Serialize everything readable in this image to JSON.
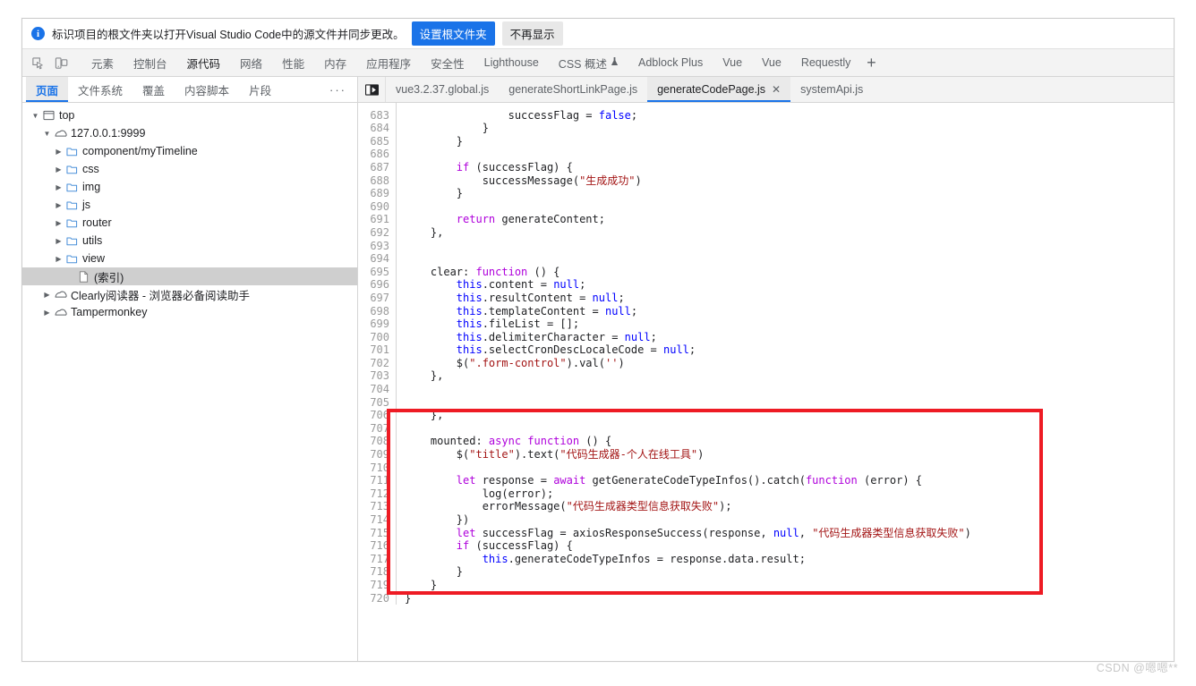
{
  "infobar": {
    "icon": "info-icon",
    "message": "标识项目的根文件夹以打开Visual Studio Code中的源文件并同步更改。",
    "primary_button": "设置根文件夹",
    "secondary_button": "不再显示"
  },
  "main_tabs": {
    "inspect_icon": "inspect-element-icon",
    "device_icon": "device-toolbar-icon",
    "add_label": "+",
    "items": [
      {
        "label": "元素",
        "selected": false
      },
      {
        "label": "控制台",
        "selected": false
      },
      {
        "label": "源代码",
        "selected": true
      },
      {
        "label": "网络",
        "selected": false
      },
      {
        "label": "性能",
        "selected": false
      },
      {
        "label": "内存",
        "selected": false
      },
      {
        "label": "应用程序",
        "selected": false
      },
      {
        "label": "安全性",
        "selected": false
      },
      {
        "label": "Lighthouse",
        "selected": false
      },
      {
        "label": "CSS 概述",
        "selected": false,
        "flask": true
      },
      {
        "label": "Adblock Plus",
        "selected": false
      },
      {
        "label": "Vue",
        "selected": false
      },
      {
        "label": "Vue",
        "selected": false
      },
      {
        "label": "Requestly",
        "selected": false
      }
    ]
  },
  "navigator": {
    "tabs": [
      {
        "label": "页面",
        "selected": true
      },
      {
        "label": "文件系统",
        "selected": false
      },
      {
        "label": "覆盖",
        "selected": false
      },
      {
        "label": "内容脚本",
        "selected": false
      },
      {
        "label": "片段",
        "selected": false
      }
    ],
    "more_label": "···",
    "tree": [
      {
        "label": "top",
        "indent": 0,
        "icon": "frame-icon",
        "arrow": "down",
        "selected": false
      },
      {
        "label": "127.0.0.1:9999",
        "indent": 1,
        "icon": "cloud-icon",
        "arrow": "down",
        "selected": false
      },
      {
        "label": "component/myTimeline",
        "indent": 2,
        "icon": "folder-icon",
        "arrow": "right",
        "selected": false
      },
      {
        "label": "css",
        "indent": 2,
        "icon": "folder-icon",
        "arrow": "right",
        "selected": false
      },
      {
        "label": "img",
        "indent": 2,
        "icon": "folder-icon",
        "arrow": "right",
        "selected": false
      },
      {
        "label": "js",
        "indent": 2,
        "icon": "folder-icon",
        "arrow": "right",
        "selected": false
      },
      {
        "label": "router",
        "indent": 2,
        "icon": "folder-icon",
        "arrow": "right",
        "selected": false
      },
      {
        "label": "utils",
        "indent": 2,
        "icon": "folder-icon",
        "arrow": "right",
        "selected": false
      },
      {
        "label": "view",
        "indent": 2,
        "icon": "folder-icon",
        "arrow": "right",
        "selected": false
      },
      {
        "label": "(索引)",
        "indent": 3,
        "icon": "document-icon",
        "arrow": "none",
        "selected": true
      },
      {
        "label": "Clearly阅读器 - 浏览器必备阅读助手",
        "indent": 1,
        "icon": "cloud-icon",
        "arrow": "right",
        "selected": false
      },
      {
        "label": "Tampermonkey",
        "indent": 1,
        "icon": "cloud-icon",
        "arrow": "right",
        "selected": false
      }
    ]
  },
  "sources": {
    "collapse_icon": "collapse-sidebar-icon",
    "file_tabs": [
      {
        "label": "vue3.2.37.global.js",
        "selected": false,
        "closable": false
      },
      {
        "label": "generateShortLinkPage.js",
        "selected": false,
        "closable": false
      },
      {
        "label": "generateCodePage.js",
        "selected": true,
        "closable": true
      },
      {
        "label": "systemApi.js",
        "selected": false,
        "closable": false
      }
    ],
    "close_glyph": "✕",
    "code": [
      {
        "n": "",
        "segs": [
          {
            "t": "                ",
            "c": ""
          }
        ]
      },
      {
        "n": "683",
        "segs": [
          {
            "t": "                ",
            "c": ""
          },
          {
            "t": "successFlag = ",
            "c": ""
          },
          {
            "t": "false",
            "c": "kw2"
          },
          {
            "t": ";",
            "c": ""
          }
        ]
      },
      {
        "n": "684",
        "segs": [
          {
            "t": "            }",
            "c": ""
          }
        ]
      },
      {
        "n": "685",
        "segs": [
          {
            "t": "        }",
            "c": ""
          }
        ]
      },
      {
        "n": "686",
        "segs": [
          {
            "t": "",
            "c": ""
          }
        ]
      },
      {
        "n": "687",
        "segs": [
          {
            "t": "        ",
            "c": ""
          },
          {
            "t": "if",
            "c": "kw"
          },
          {
            "t": " (successFlag) {",
            "c": ""
          }
        ]
      },
      {
        "n": "688",
        "segs": [
          {
            "t": "            successMessage(",
            "c": ""
          },
          {
            "t": "\"生成成功\"",
            "c": "str"
          },
          {
            "t": ")",
            "c": ""
          }
        ]
      },
      {
        "n": "689",
        "segs": [
          {
            "t": "        }",
            "c": ""
          }
        ]
      },
      {
        "n": "690",
        "segs": [
          {
            "t": "",
            "c": ""
          }
        ]
      },
      {
        "n": "691",
        "segs": [
          {
            "t": "        ",
            "c": ""
          },
          {
            "t": "return",
            "c": "kw"
          },
          {
            "t": " generateContent;",
            "c": ""
          }
        ]
      },
      {
        "n": "692",
        "segs": [
          {
            "t": "    },",
            "c": ""
          }
        ]
      },
      {
        "n": "693",
        "segs": [
          {
            "t": "",
            "c": ""
          }
        ]
      },
      {
        "n": "694",
        "segs": [
          {
            "t": "",
            "c": ""
          }
        ]
      },
      {
        "n": "695",
        "segs": [
          {
            "t": "    clear: ",
            "c": ""
          },
          {
            "t": "function",
            "c": "kw"
          },
          {
            "t": " () {",
            "c": ""
          }
        ]
      },
      {
        "n": "696",
        "segs": [
          {
            "t": "        ",
            "c": ""
          },
          {
            "t": "this",
            "c": "this"
          },
          {
            "t": ".content = ",
            "c": ""
          },
          {
            "t": "null",
            "c": "kw2"
          },
          {
            "t": ";",
            "c": ""
          }
        ]
      },
      {
        "n": "697",
        "segs": [
          {
            "t": "        ",
            "c": ""
          },
          {
            "t": "this",
            "c": "this"
          },
          {
            "t": ".resultContent = ",
            "c": ""
          },
          {
            "t": "null",
            "c": "kw2"
          },
          {
            "t": ";",
            "c": ""
          }
        ]
      },
      {
        "n": "698",
        "segs": [
          {
            "t": "        ",
            "c": ""
          },
          {
            "t": "this",
            "c": "this"
          },
          {
            "t": ".templateContent = ",
            "c": ""
          },
          {
            "t": "null",
            "c": "kw2"
          },
          {
            "t": ";",
            "c": ""
          }
        ]
      },
      {
        "n": "699",
        "segs": [
          {
            "t": "        ",
            "c": ""
          },
          {
            "t": "this",
            "c": "this"
          },
          {
            "t": ".fileList = [];",
            "c": ""
          }
        ]
      },
      {
        "n": "700",
        "segs": [
          {
            "t": "        ",
            "c": ""
          },
          {
            "t": "this",
            "c": "this"
          },
          {
            "t": ".delimiterCharacter = ",
            "c": ""
          },
          {
            "t": "null",
            "c": "kw2"
          },
          {
            "t": ";",
            "c": ""
          }
        ]
      },
      {
        "n": "701",
        "segs": [
          {
            "t": "        ",
            "c": ""
          },
          {
            "t": "this",
            "c": "this"
          },
          {
            "t": ".selectCronDescLocaleCode = ",
            "c": ""
          },
          {
            "t": "null",
            "c": "kw2"
          },
          {
            "t": ";",
            "c": ""
          }
        ]
      },
      {
        "n": "702",
        "segs": [
          {
            "t": "        $(",
            "c": ""
          },
          {
            "t": "\".form-control\"",
            "c": "str"
          },
          {
            "t": ").val(",
            "c": ""
          },
          {
            "t": "''",
            "c": "str"
          },
          {
            "t": ")",
            "c": ""
          }
        ]
      },
      {
        "n": "703",
        "segs": [
          {
            "t": "    },",
            "c": ""
          }
        ]
      },
      {
        "n": "704",
        "segs": [
          {
            "t": "",
            "c": ""
          }
        ]
      },
      {
        "n": "705",
        "segs": [
          {
            "t": "",
            "c": ""
          }
        ]
      },
      {
        "n": "706",
        "segs": [
          {
            "t": "    },",
            "c": ""
          }
        ]
      },
      {
        "n": "707",
        "segs": [
          {
            "t": "",
            "c": ""
          }
        ]
      },
      {
        "n": "708",
        "segs": [
          {
            "t": "    mounted: ",
            "c": ""
          },
          {
            "t": "async function",
            "c": "kw"
          },
          {
            "t": " () {",
            "c": ""
          }
        ]
      },
      {
        "n": "709",
        "segs": [
          {
            "t": "        $(",
            "c": ""
          },
          {
            "t": "\"title\"",
            "c": "str"
          },
          {
            "t": ").text(",
            "c": ""
          },
          {
            "t": "\"代码生成器-个人在线工具\"",
            "c": "str"
          },
          {
            "t": ")",
            "c": ""
          }
        ]
      },
      {
        "n": "710",
        "segs": [
          {
            "t": "",
            "c": ""
          }
        ]
      },
      {
        "n": "711",
        "segs": [
          {
            "t": "        ",
            "c": ""
          },
          {
            "t": "let",
            "c": "kw"
          },
          {
            "t": " response = ",
            "c": ""
          },
          {
            "t": "await",
            "c": "kw"
          },
          {
            "t": " getGenerateCodeTypeInfos().catch(",
            "c": ""
          },
          {
            "t": "function",
            "c": "kw"
          },
          {
            "t": " (error) {",
            "c": ""
          }
        ]
      },
      {
        "n": "712",
        "segs": [
          {
            "t": "            log(error);",
            "c": ""
          }
        ]
      },
      {
        "n": "713",
        "segs": [
          {
            "t": "            errorMessage(",
            "c": ""
          },
          {
            "t": "\"代码生成器类型信息获取失败\"",
            "c": "str"
          },
          {
            "t": ");",
            "c": ""
          }
        ]
      },
      {
        "n": "714",
        "segs": [
          {
            "t": "        })",
            "c": ""
          }
        ]
      },
      {
        "n": "715",
        "segs": [
          {
            "t": "        ",
            "c": ""
          },
          {
            "t": "let",
            "c": "kw"
          },
          {
            "t": " successFlag = axiosResponseSuccess(response, ",
            "c": ""
          },
          {
            "t": "null",
            "c": "kw2"
          },
          {
            "t": ", ",
            "c": ""
          },
          {
            "t": "\"代码生成器类型信息获取失败\"",
            "c": "str"
          },
          {
            "t": ")",
            "c": ""
          }
        ]
      },
      {
        "n": "716",
        "segs": [
          {
            "t": "        ",
            "c": ""
          },
          {
            "t": "if",
            "c": "kw"
          },
          {
            "t": " (successFlag) {",
            "c": ""
          }
        ]
      },
      {
        "n": "717",
        "segs": [
          {
            "t": "            ",
            "c": ""
          },
          {
            "t": "this",
            "c": "this"
          },
          {
            "t": ".generateCodeTypeInfos = response.data.result;",
            "c": ""
          }
        ]
      },
      {
        "n": "718",
        "segs": [
          {
            "t": "        }",
            "c": ""
          }
        ]
      },
      {
        "n": "719",
        "segs": [
          {
            "t": "    }",
            "c": ""
          }
        ]
      },
      {
        "n": "720",
        "segs": [
          {
            "t": "}",
            "c": ""
          }
        ]
      }
    ]
  },
  "annotation": {
    "box_color": "#ee1b24",
    "name": "red-highlight-box"
  },
  "watermark": {
    "text": "CSDN @嗯嗯**"
  }
}
